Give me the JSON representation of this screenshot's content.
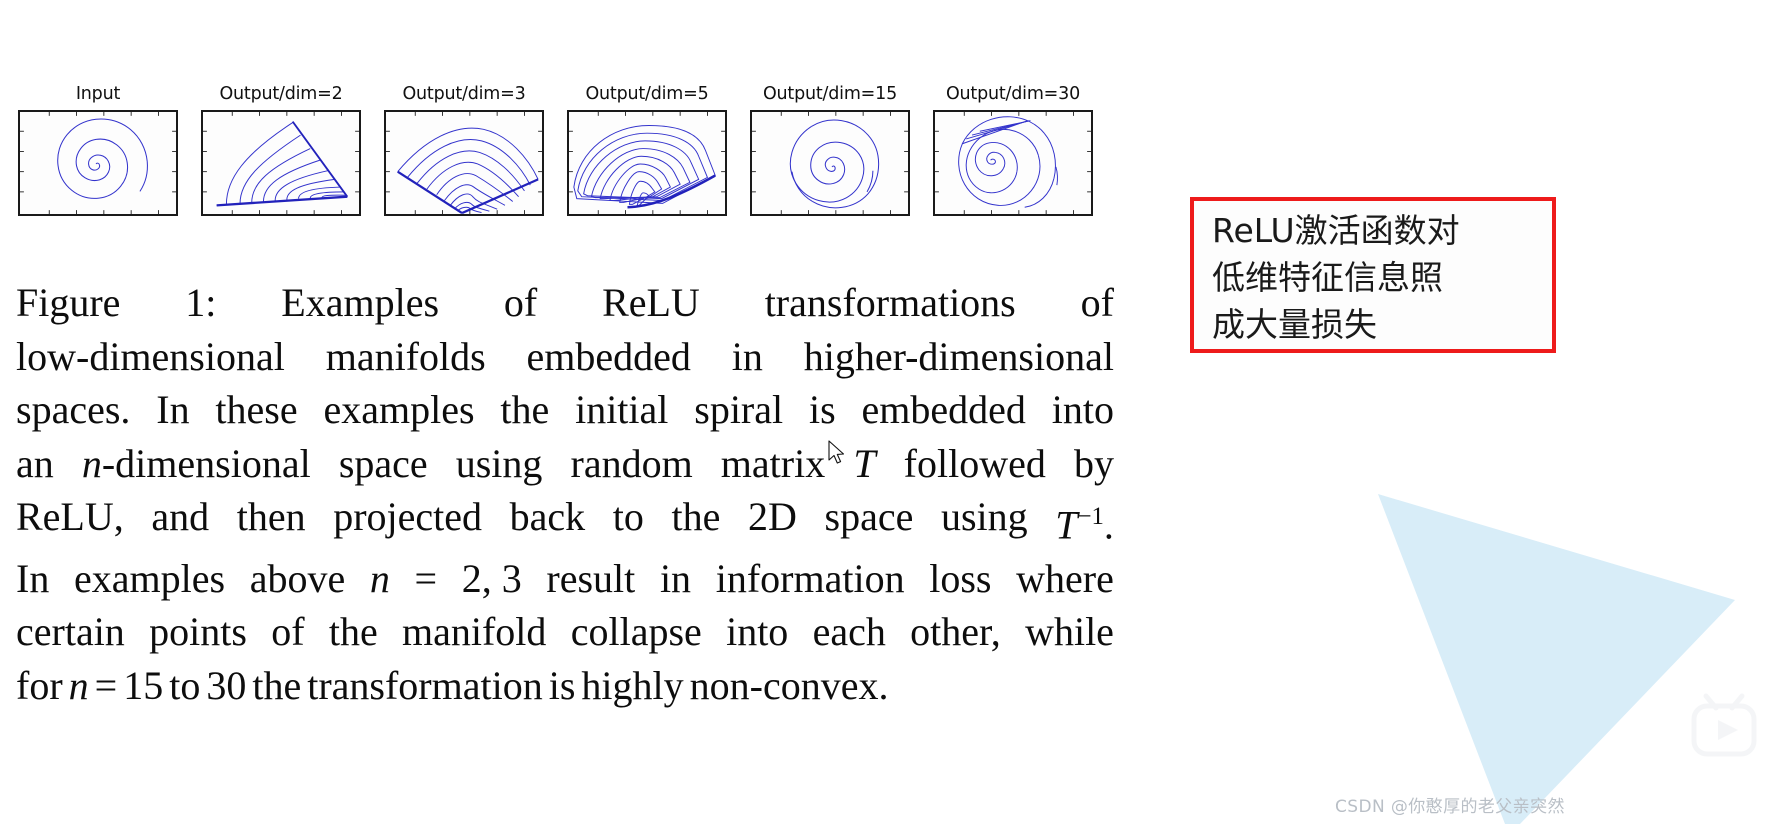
{
  "figure": {
    "panels": [
      {
        "title": "Input",
        "kind": "spiral-round"
      },
      {
        "title": "Output/dim=2",
        "kind": "fan-wedge"
      },
      {
        "title": "Output/dim=3",
        "kind": "fan-fold"
      },
      {
        "title": "Output/dim=5",
        "kind": "lobe"
      },
      {
        "title": "Output/dim=15",
        "kind": "spiral-triangleish"
      },
      {
        "title": "Output/dim=30",
        "kind": "spiral-skewed"
      }
    ],
    "curve_color": "#3333cc",
    "axis_color": "#1a1a1a"
  },
  "caption": {
    "lines": [
      {
        "justify": true,
        "words": [
          "Figure",
          "1:",
          "Examples",
          "of",
          "ReLU",
          "transformations",
          "of"
        ]
      },
      {
        "justify": true,
        "words": [
          "low-dimensional",
          "manifolds",
          "embedded",
          "in",
          "higher-dimensional"
        ]
      },
      {
        "justify": true,
        "words": [
          "spaces.",
          "In",
          "these",
          "examples",
          "the",
          "initial",
          "spiral",
          "is",
          "embedded",
          "into"
        ]
      },
      {
        "justify": true,
        "words": [
          "an",
          "n-dimensional",
          "space",
          "using",
          "random",
          "matrix",
          "T",
          "followed",
          "by"
        ]
      },
      {
        "justify": true,
        "words": [
          "ReLU,",
          "and",
          "then",
          "projected",
          "back",
          "to",
          "the",
          "2D",
          "space",
          "using",
          "T-1."
        ]
      },
      {
        "justify": true,
        "words": [
          "In",
          "examples",
          "above",
          "n",
          "=",
          "2, 3",
          "result",
          "in",
          "information",
          "loss",
          "where"
        ]
      },
      {
        "justify": true,
        "words": [
          "certain",
          "points",
          "of",
          "the",
          "manifold",
          "collapse",
          "into",
          "each",
          "other,",
          "while"
        ]
      },
      {
        "justify": false,
        "words": [
          "for",
          "n",
          "=",
          "15",
          "to",
          "30",
          "the",
          "transformation",
          "is",
          "highly",
          "non-convex."
        ]
      }
    ],
    "full_text": "Figure 1: Examples of ReLU transformations of low-dimensional manifolds embedded in higher-dimensional spaces. In these examples the initial spiral is embedded into an n-dimensional space using random matrix T followed by ReLU, and then projected back to the 2D space using T-1. In examples above n = 2, 3 result in information loss where certain points of the manifold collapse into each other, while for n = 15 to 30 the transformation is highly non-convex."
  },
  "annotation": {
    "border_color": "#ee1b1b",
    "lines": [
      "ReLU激活函数对",
      "低维特征信息照",
      "成大量损失"
    ]
  },
  "decoration": {
    "triangle_color": "#d8edf8"
  },
  "watermark": {
    "text": "CSDN @你憨厚的老父亲突然",
    "color": "#b9bfc6"
  }
}
